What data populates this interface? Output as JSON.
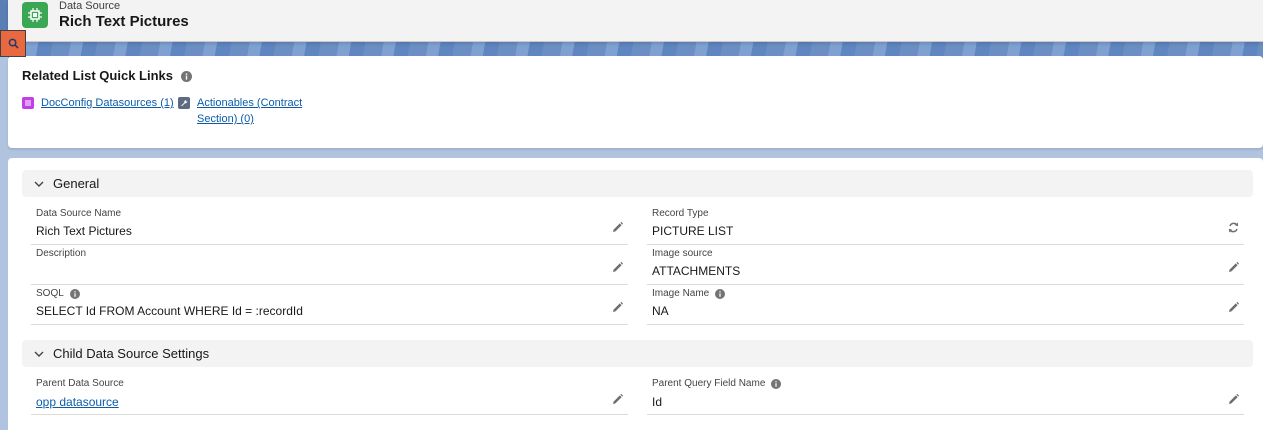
{
  "header": {
    "object_label": "Data Source",
    "record_title": "Rich Text Pictures"
  },
  "quick_links": {
    "title": "Related List Quick Links",
    "items": [
      {
        "label": "DocConfig Datasources (1)",
        "icon": "list-icon",
        "color": "#c23ee8"
      },
      {
        "label_line1": "Actionables (Contract",
        "label_line2": "Section) (0)",
        "icon": "wrench-icon",
        "color": "#5c6b80"
      }
    ]
  },
  "sections": {
    "general": {
      "title": "General",
      "fields": {
        "data_source_name": {
          "label": "Data Source Name",
          "value": "Rich Text Pictures"
        },
        "record_type": {
          "label": "Record Type",
          "value": "PICTURE LIST"
        },
        "description": {
          "label": "Description",
          "value": ""
        },
        "image_source": {
          "label": "Image source",
          "value": "ATTACHMENTS"
        },
        "soql": {
          "label": "SOQL",
          "value": "SELECT Id FROM Account WHERE Id = :recordId"
        },
        "image_name": {
          "label": "Image Name",
          "value": "NA"
        }
      }
    },
    "child": {
      "title": "Child Data Source Settings",
      "fields": {
        "parent_data_source": {
          "label": "Parent Data Source",
          "value": "opp datasource"
        },
        "parent_query_field_name": {
          "label": "Parent Query Field Name",
          "value": "Id"
        }
      }
    }
  },
  "colors": {
    "accent_link": "#0b5cab",
    "header_icon": "#3ba755",
    "search_tab": "#e8683f"
  }
}
